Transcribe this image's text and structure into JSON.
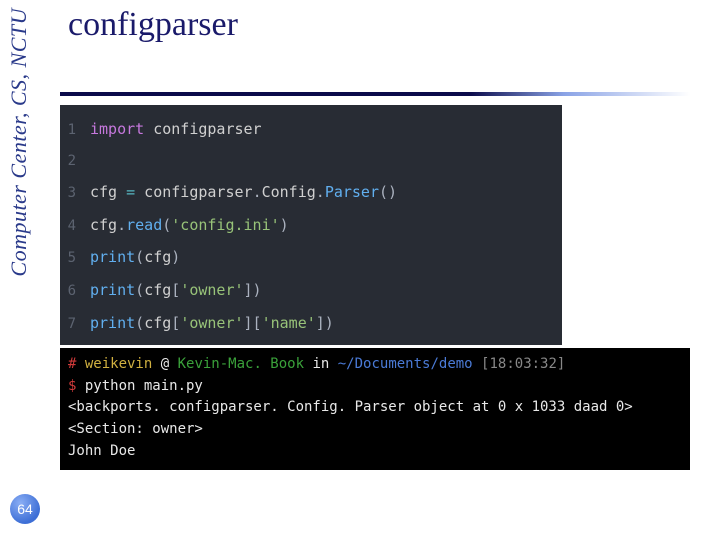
{
  "sidebar": {
    "org": "Computer Center, CS, NCTU"
  },
  "title": "configparser",
  "page_number": "64",
  "code": {
    "lines": [
      {
        "n": "1",
        "tokens": [
          [
            "kw",
            "import"
          ],
          [
            "d",
            " "
          ],
          [
            "ident",
            "configparser"
          ]
        ]
      },
      {
        "n": "2",
        "tokens": []
      },
      {
        "n": "3",
        "tokens": [
          [
            "ident",
            "cfg "
          ],
          [
            "op",
            "="
          ],
          [
            "ident",
            " configparser"
          ],
          [
            "d",
            "."
          ],
          [
            "ident",
            "Config"
          ],
          [
            "d",
            "."
          ],
          [
            "fn",
            "Parser"
          ],
          [
            "d",
            "()"
          ]
        ]
      },
      {
        "n": "4",
        "tokens": [
          [
            "ident",
            "cfg"
          ],
          [
            "d",
            "."
          ],
          [
            "fn",
            "read"
          ],
          [
            "d",
            "("
          ],
          [
            "str",
            "'config.ini'"
          ],
          [
            "d",
            ")"
          ]
        ]
      },
      {
        "n": "5",
        "tokens": [
          [
            "fn",
            "print"
          ],
          [
            "d",
            "("
          ],
          [
            "ident",
            "cfg"
          ],
          [
            "d",
            ")"
          ]
        ]
      },
      {
        "n": "6",
        "tokens": [
          [
            "fn",
            "print"
          ],
          [
            "d",
            "("
          ],
          [
            "ident",
            "cfg"
          ],
          [
            "d",
            "["
          ],
          [
            "str",
            "'owner'"
          ],
          [
            "d",
            "])"
          ]
        ]
      },
      {
        "n": "7",
        "tokens": [
          [
            "fn",
            "print"
          ],
          [
            "d",
            "("
          ],
          [
            "ident",
            "cfg"
          ],
          [
            "d",
            "["
          ],
          [
            "str",
            "'owner'"
          ],
          [
            "d",
            "]["
          ],
          [
            "str",
            "'name'"
          ],
          [
            "d",
            "])"
          ]
        ]
      }
    ]
  },
  "terminal": {
    "lines": [
      {
        "segs": [
          [
            "tred",
            "# "
          ],
          [
            "tyellow",
            "weikevin"
          ],
          [
            "twhite",
            " @ "
          ],
          [
            "tgreen",
            "Kevin-Mac. Book"
          ],
          [
            "twhite",
            " in "
          ],
          [
            "tblue",
            "~/Documents/demo"
          ],
          [
            "twhite",
            " "
          ],
          [
            "tgray",
            "[18:03:32]"
          ]
        ]
      },
      {
        "segs": [
          [
            "tred",
            "$ "
          ],
          [
            "twhite",
            "python main.py"
          ]
        ]
      },
      {
        "segs": [
          [
            "twhite",
            "<backports. configparser. Config. Parser object at 0 x 1033 daad 0>"
          ]
        ]
      },
      {
        "segs": [
          [
            "twhite",
            "<Section: owner>"
          ]
        ]
      },
      {
        "segs": [
          [
            "twhite",
            "John Doe"
          ]
        ]
      }
    ]
  }
}
